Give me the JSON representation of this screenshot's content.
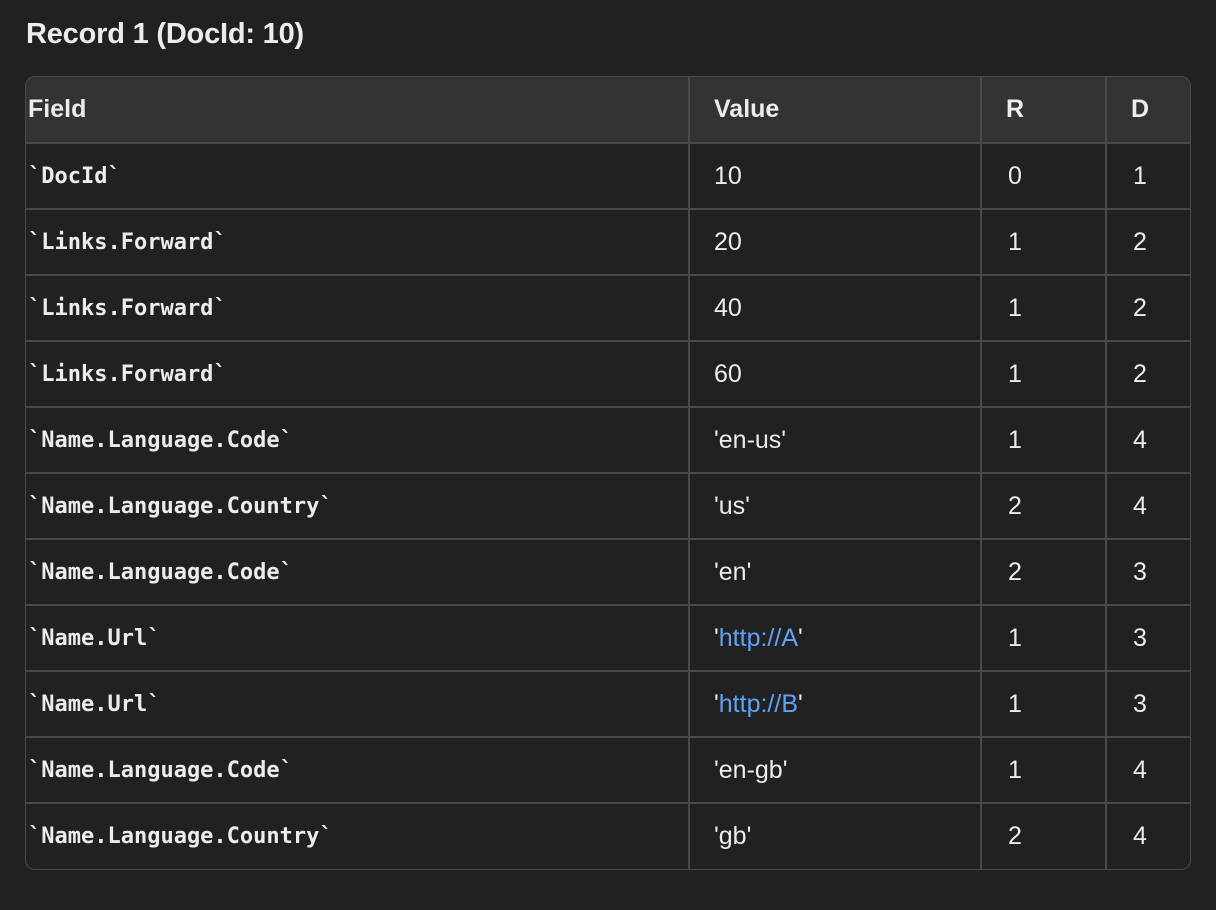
{
  "title": "Record 1 (DocId: 10)",
  "table": {
    "headers": [
      "Field",
      "Value",
      "R",
      "D"
    ],
    "rows": [
      {
        "field": "`DocId`",
        "value": "10",
        "link": "",
        "suffix": "",
        "r": "0",
        "d": "1"
      },
      {
        "field": "`Links.Forward`",
        "value": "20",
        "link": "",
        "suffix": "",
        "r": "1",
        "d": "2"
      },
      {
        "field": "`Links.Forward`",
        "value": "40",
        "link": "",
        "suffix": "",
        "r": "1",
        "d": "2"
      },
      {
        "field": "`Links.Forward`",
        "value": "60",
        "link": "",
        "suffix": "",
        "r": "1",
        "d": "2"
      },
      {
        "field": "`Name.Language.Code`",
        "value": "'en-us'",
        "link": "",
        "suffix": "",
        "r": "1",
        "d": "4"
      },
      {
        "field": "`Name.Language.Country`",
        "value": "'us'",
        "link": "",
        "suffix": "",
        "r": "2",
        "d": "4"
      },
      {
        "field": "`Name.Language.Code`",
        "value": "'en'",
        "link": "",
        "suffix": "",
        "r": "2",
        "d": "3"
      },
      {
        "field": "`Name.Url`",
        "value": "'",
        "link": "http://A",
        "suffix": "'",
        "r": "1",
        "d": "3"
      },
      {
        "field": "`Name.Url`",
        "value": "'",
        "link": "http://B",
        "suffix": "'",
        "r": "1",
        "d": "3"
      },
      {
        "field": "`Name.Language.Code`",
        "value": "'en-gb'",
        "link": "",
        "suffix": "",
        "r": "1",
        "d": "4"
      },
      {
        "field": "`Name.Language.Country`",
        "value": "'gb'",
        "link": "",
        "suffix": "",
        "r": "2",
        "d": "4"
      }
    ]
  },
  "colors": {
    "background": "#212121",
    "header_bg": "#333333",
    "border": "#494949",
    "text": "#ececec",
    "link": "#5ea1f5"
  }
}
